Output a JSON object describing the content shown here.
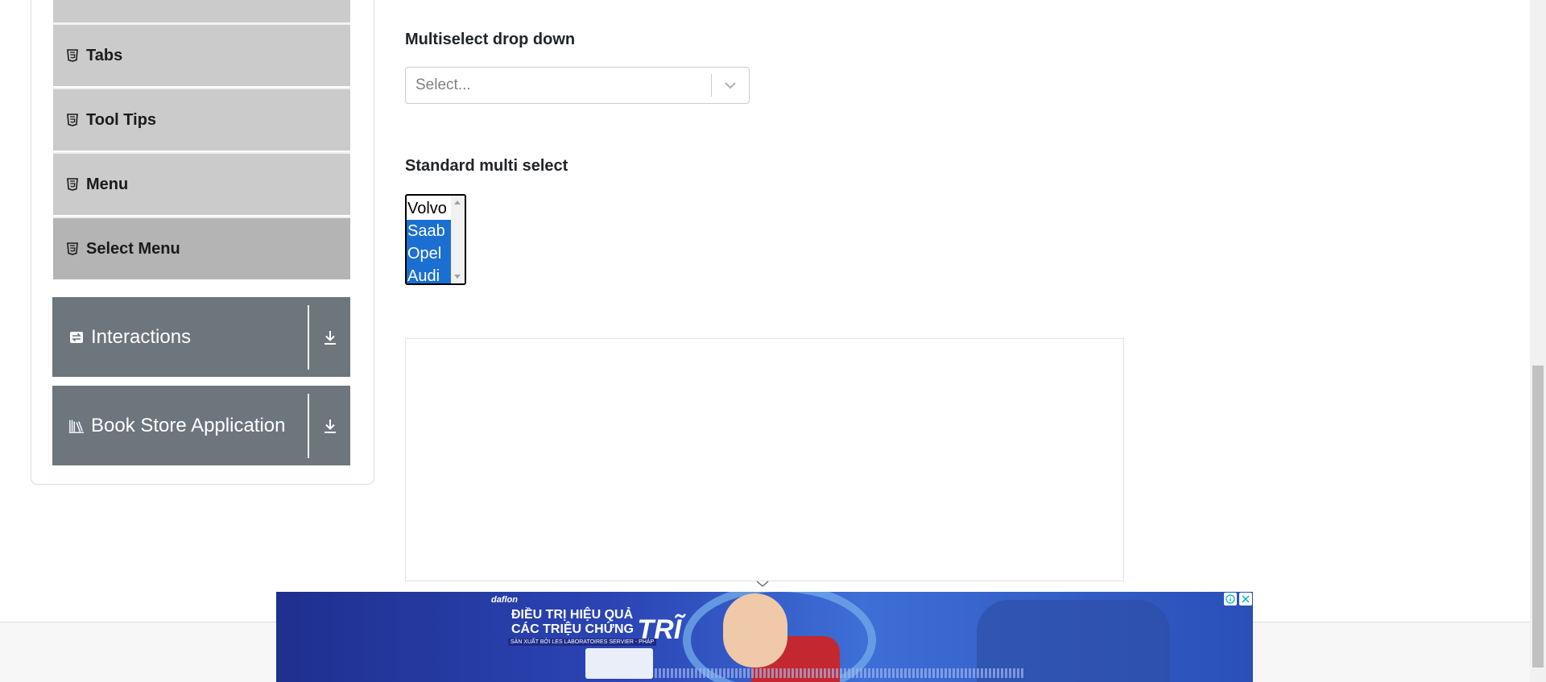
{
  "sidebar": {
    "elements_items": [
      {
        "label": "Tabs",
        "icon": "html5-icon",
        "active": false
      },
      {
        "label": "Tool Tips",
        "icon": "html5-icon",
        "active": false
      },
      {
        "label": "Menu",
        "icon": "html5-icon",
        "active": false
      },
      {
        "label": "Select Menu",
        "icon": "html5-icon",
        "active": true
      }
    ],
    "groups": [
      {
        "label": "Interactions",
        "icon": "swap-icon",
        "arrow": "download-arrow-icon"
      },
      {
        "label": "Book Store Application",
        "icon": "books-icon",
        "arrow": "download-arrow-icon"
      }
    ]
  },
  "main": {
    "multiselect_title": "Multiselect drop down",
    "multiselect_placeholder": "Select...",
    "standard_title": "Standard multi select",
    "standard_options": [
      {
        "label": "Volvo",
        "selected": false
      },
      {
        "label": "Saab",
        "selected": true
      },
      {
        "label": "Opel",
        "selected": true
      },
      {
        "label": "Audi",
        "selected": true
      }
    ]
  },
  "ad": {
    "brand": "daflon",
    "headline_line1": "ĐIỀU TRỊ HIỆU QUẢ",
    "headline_line2": "CÁC TRIỆU CHỨNG",
    "headline_big": "TRĨ",
    "subline": "SẢN XUẤT BỞI LES LABORATOIRES SERVIER - PHÁP"
  },
  "colors": {
    "sidebar_item_bg": "#cbcbcb",
    "sidebar_active_bg": "#b4b4b4",
    "group_header_bg": "#6d757d",
    "selected_option_bg": "#1a6fd1"
  }
}
